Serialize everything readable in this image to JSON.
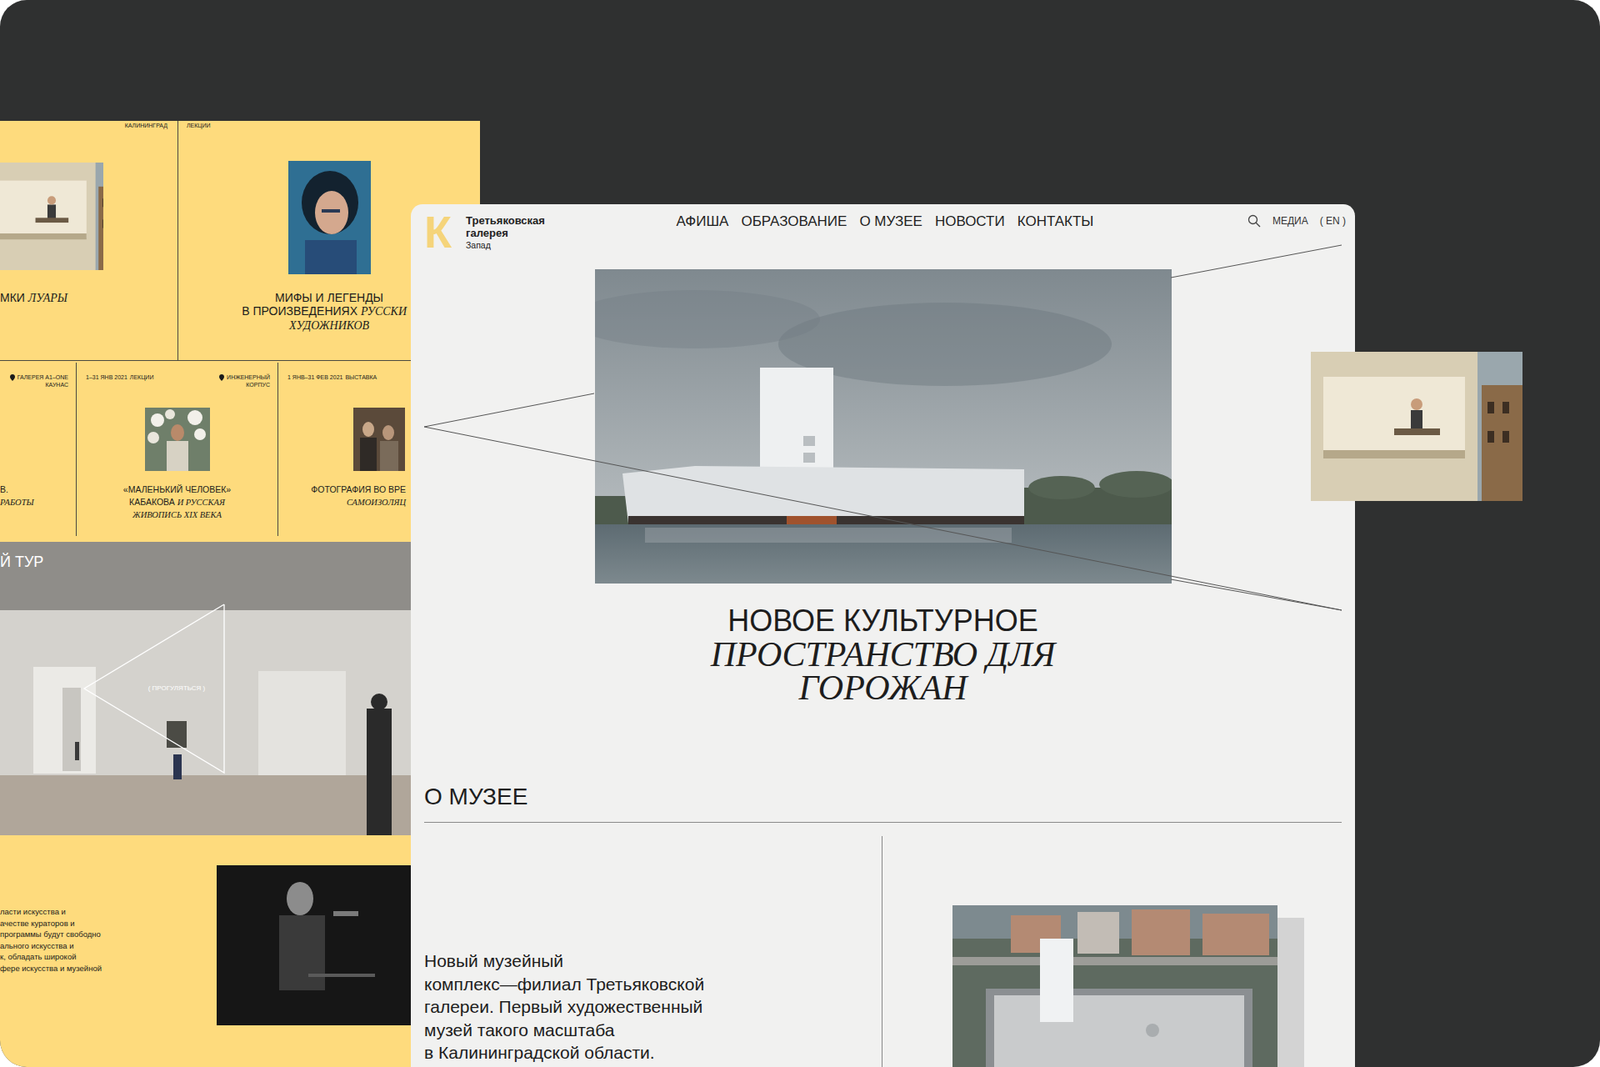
{
  "back_page": {
    "featured_events": [
      {
        "date": [],
        "location": [
          "КАЛИНИНГРАД"
        ],
        "title": [
          [
            {
              "text": "МКИ ",
              "italic": false
            },
            {
              "text": "ЛУАРЫ",
              "italic": true
            }
          ]
        ]
      },
      {
        "date": [
          "ЛЕКЦИИ"
        ],
        "location": [],
        "title": [
          [
            {
              "text": "МИФЫ И ЛЕГЕНДЫ",
              "italic": false
            }
          ],
          [
            {
              "text": "В ПРОИЗВЕДЕНИЯХ ",
              "italic": false
            },
            {
              "text": "РУССКИ",
              "italic": true
            }
          ],
          [
            {
              "text": "ХУДОЖНИКОВ",
              "italic": true
            }
          ]
        ]
      }
    ],
    "events": [
      {
        "date": [],
        "location": [
          "ГАЛЕРЕЯ А1–ONE",
          "КАУНАС"
        ],
        "title": [
          [
            {
              "text": "В.",
              "italic": false
            }
          ],
          [
            {
              "text": "РАБОТЫ",
              "italic": true
            }
          ]
        ]
      },
      {
        "date": [
          "1–31 ЯНВ 2021",
          "ЛЕКЦИИ"
        ],
        "location": [
          "ИНЖЕНЕРНЫЙ",
          "КОРПУС"
        ],
        "title": [
          [
            {
              "text": "«МАЛЕНЬКИЙ ЧЕЛОВЕК»",
              "italic": false
            }
          ],
          [
            {
              "text": "КАБАКОВА ",
              "italic": false
            },
            {
              "text": "И РУССКАЯ",
              "italic": true
            }
          ],
          [
            {
              "text": "ЖИВОПИСЬ XIX ВЕКА",
              "italic": true
            }
          ]
        ]
      },
      {
        "date": [
          "1 ЯНВ–31 ФЕВ 2021",
          "ВЫСТАВКА"
        ],
        "location": [],
        "title": [
          [
            {
              "text": "ФОТОГРАФИЯ ВО ВРЕ",
              "italic": false
            }
          ],
          [
            {
              "text": "САМОИЗОЛЯЦ",
              "italic": true
            }
          ]
        ]
      }
    ],
    "tour": {
      "title": "Й ТУР",
      "button": "( ПРОГУЛЯТЬСЯ )"
    },
    "about_lines": [
      "ласти искусства и",
      "ачестве кураторов и",
      "программы будут свободно",
      "ального искусства и",
      "к, обладать широкой",
      "фере искусства и музейной"
    ]
  },
  "front_page": {
    "logo": {
      "mark": "К",
      "name_lines": [
        "Третьяковская",
        "галерея"
      ],
      "branch": "Запад"
    },
    "nav": [
      "АФИША",
      "ОБРАЗОВАНИЕ",
      "О МУЗЕЕ",
      "НОВОСТИ",
      "КОНТАКТЫ"
    ],
    "media": "МЕДИА",
    "language": "( EN )",
    "headline": {
      "line": "НОВОЕ КУЛЬТУРНОЕ",
      "italic_lines": [
        "ПРОСТРАНСТВО ДЛЯ",
        "ГОРОЖАН"
      ]
    },
    "about": {
      "heading": "О МУЗЕЕ",
      "text_lines": [
        "Новый музейный",
        "комплекс—филиал Третьяковской",
        "галереи. Первый художественный",
        "музей такого масштаба",
        "в Калининградской области."
      ]
    }
  }
}
